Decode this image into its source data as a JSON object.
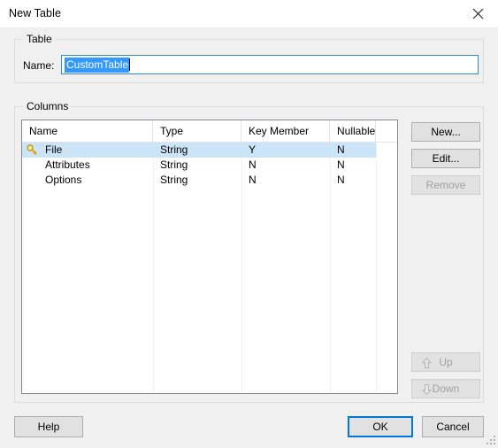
{
  "window": {
    "title": "New Table",
    "close_icon": "close-icon"
  },
  "table_group": {
    "legend": "Table",
    "name_label": "Name:",
    "name_value": "CustomTable",
    "name_placeholder": ""
  },
  "columns_group": {
    "legend": "Columns",
    "headers": [
      "Name",
      "Type",
      "Key Member",
      "Nullable"
    ],
    "rows": [
      {
        "name": "File",
        "type": "String",
        "key_member": "Y",
        "nullable": "N",
        "icon": "key-icon",
        "selected": true
      },
      {
        "name": "Attributes",
        "type": "String",
        "key_member": "N",
        "nullable": "N",
        "icon": "",
        "selected": false
      },
      {
        "name": "Options",
        "type": "String",
        "key_member": "N",
        "nullable": "N",
        "icon": "",
        "selected": false
      }
    ]
  },
  "side_buttons": {
    "new_label": "New...",
    "edit_label": "Edit...",
    "remove_label": "Remove",
    "up_label": "Up",
    "down_label": "Down"
  },
  "footer": {
    "help_label": "Help",
    "ok_label": "OK",
    "cancel_label": "Cancel"
  },
  "colors": {
    "dialog_bg": "#f0f0f0",
    "titlebar_bg": "#ffffff",
    "selection_blue": "#cce4f7",
    "text_selection_blue": "#3399ff",
    "focus_border": "#0078d7",
    "input_border": "#2a8ad4",
    "key_icon_gold": "#f2c649",
    "disabled_text": "#a0a0a0"
  }
}
